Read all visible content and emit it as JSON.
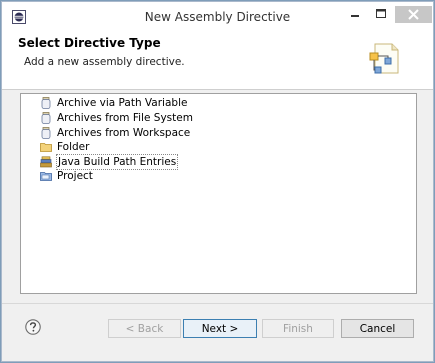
{
  "window": {
    "title": "New Assembly Directive"
  },
  "banner": {
    "heading": "Select Directive Type",
    "description": "Add a new assembly directive."
  },
  "directive_types": [
    {
      "label": "Archive via Path Variable",
      "icon": "jar-icon"
    },
    {
      "label": "Archives from File System",
      "icon": "jar-icon"
    },
    {
      "label": "Archives from Workspace",
      "icon": "jar-icon"
    },
    {
      "label": "Folder",
      "icon": "folder-icon"
    },
    {
      "label": "Java Build Path Entries",
      "icon": "library-icon"
    },
    {
      "label": "Project",
      "icon": "project-icon"
    }
  ],
  "selected_index": 4,
  "buttons": {
    "back": "< Back",
    "next": "Next >",
    "finish": "Finish",
    "cancel": "Cancel"
  },
  "colors": {
    "close_button": "#c7c7c7",
    "default_button_border": "#3c7fb1",
    "list_border": "#a0a0a0"
  }
}
